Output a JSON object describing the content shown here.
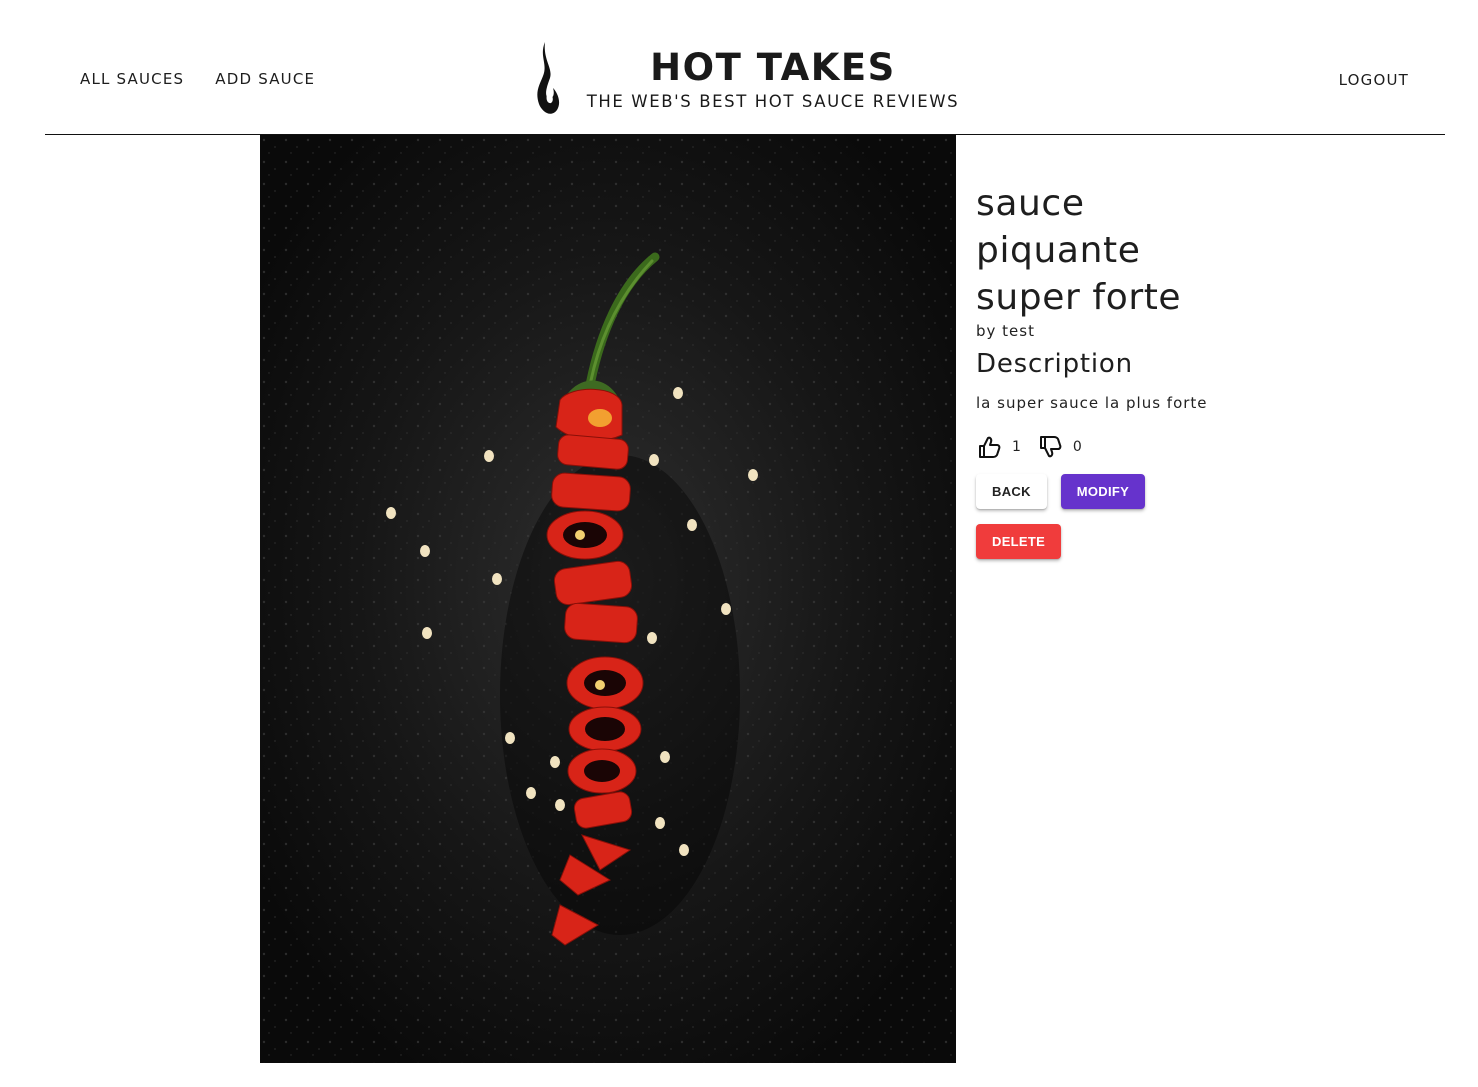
{
  "nav": {
    "all_sauces": "ALL SAUCES",
    "add_sauce": "ADD SAUCE",
    "logout": "LOGOUT"
  },
  "brand": {
    "title": "HOT TAKES",
    "subtitle": "THE WEB'S BEST HOT SAUCE REVIEWS",
    "logo_icon": "flame-icon"
  },
  "sauce": {
    "image_icon": "chili-pepper-photo",
    "name_lines": [
      "sauce",
      "piquante",
      "super forte"
    ],
    "manufacturer": "by test",
    "description_heading": "Description",
    "description": "la super sauce la plus forte",
    "likes": "1",
    "dislikes": "0"
  },
  "actions": {
    "back": "BACK",
    "modify": "MODIFY",
    "delete": "DELETE"
  },
  "colors": {
    "modify_button": "#6633cc",
    "delete_button": "#f03c3c",
    "photo_background": "#151515",
    "pepper_red": "#e0271a"
  }
}
